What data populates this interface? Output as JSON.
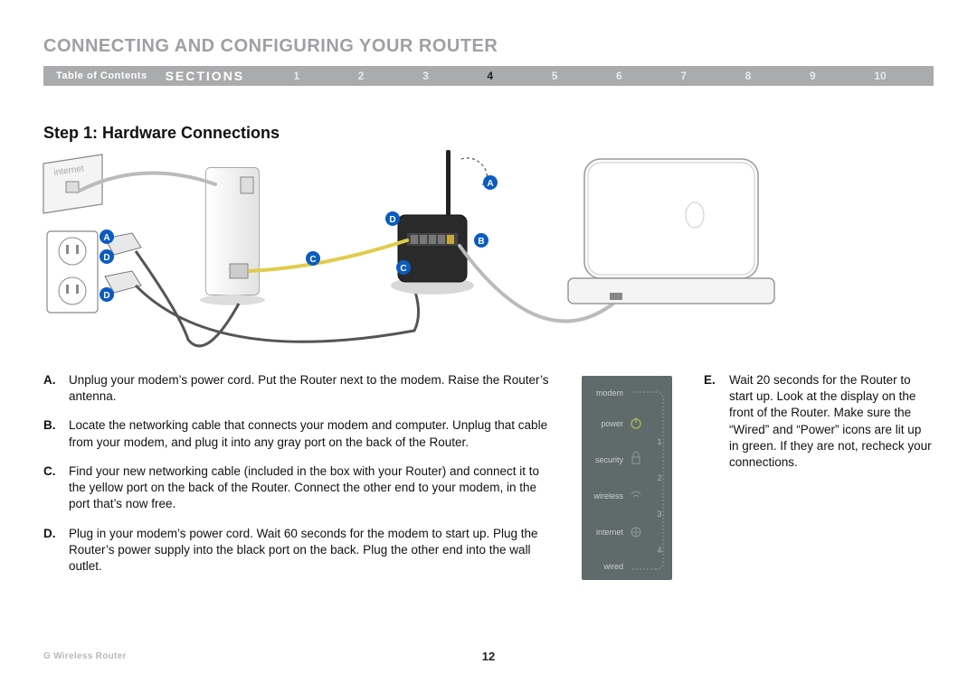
{
  "chapter_title": "CONNECTING AND CONFIGURING YOUR ROUTER",
  "nav": {
    "toc": "Table of Contents",
    "sections_label": "SECTIONS",
    "items": [
      "1",
      "2",
      "3",
      "4",
      "5",
      "6",
      "7",
      "8",
      "9",
      "10"
    ],
    "active": "4"
  },
  "step_title": "Step 1: Hardware Connections",
  "diagram": {
    "callouts": {
      "A": "A",
      "B": "B",
      "C": "C",
      "D": "D"
    },
    "wall_label": "internet"
  },
  "steps_left": [
    {
      "letter": "A.",
      "text": "Unplug your modem’s power cord. Put the Router next to the modem. Raise the Router’s antenna."
    },
    {
      "letter": "B.",
      "text": "Locate the networking cable that connects your modem and computer. Unplug that cable from your modem, and plug it into any gray port on the back of the Router."
    },
    {
      "letter": "C.",
      "text": "Find your new networking cable (included in the box with your Router) and connect it to the yellow port on the back of the Router. Connect the other end to your modem, in the port that’s now free."
    },
    {
      "letter": "D.",
      "text": "Plug in your modem’s power cord. Wait 60 seconds for the modem to start up. Plug the Router’s power supply into the black port on the back. Plug the other end into the wall outlet."
    }
  ],
  "steps_right": [
    {
      "letter": "E.",
      "text": "Wait 20 seconds for the Router to start up. Look at the display on the front of the Router. Make sure the “Wired” and “Power” icons are lit up in green. If they are not, recheck your connections."
    }
  ],
  "status_panel": {
    "rows": [
      "modem",
      "power",
      "security",
      "wireless",
      "internet",
      "wired"
    ],
    "numbers": [
      "1",
      "2",
      "3",
      "4"
    ]
  },
  "footer": {
    "product": "G Wireless Router",
    "page": "12"
  }
}
